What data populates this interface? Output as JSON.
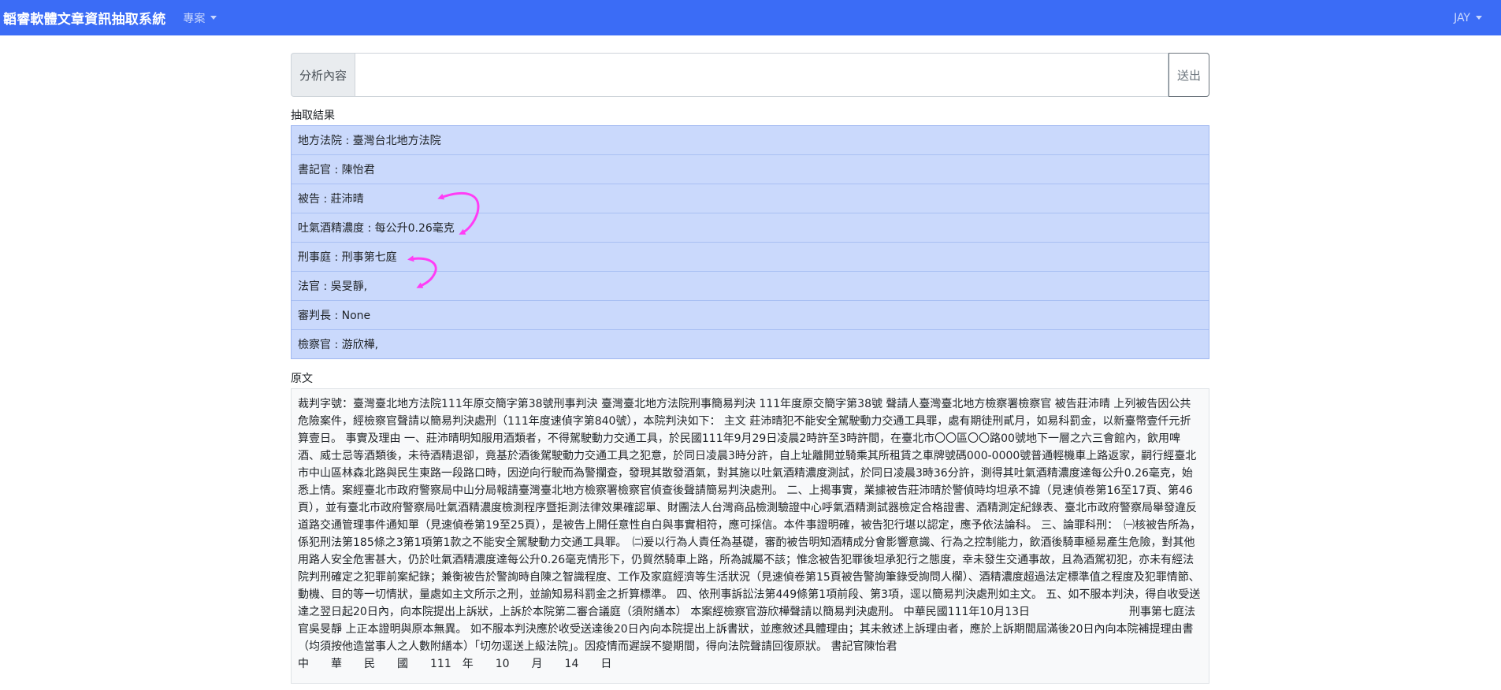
{
  "navbar": {
    "brand": "韜睿軟體文章資訊抽取系統",
    "menu_project": "專案",
    "user": "JAY"
  },
  "form": {
    "label": "分析內容",
    "input_value": "",
    "submit": "送出"
  },
  "results": {
    "heading": "抽取結果",
    "items": [
      "地方法院 : 臺灣台北地方法院",
      "書記官 : 陳怡君",
      "被告 : 莊沛晴",
      "吐氣酒精濃度 : 每公升0.26毫克",
      "刑事庭 : 刑事第七庭",
      "法官 : 吳旻靜,",
      "審判長 : None",
      "檢察官 : 游欣樺,"
    ]
  },
  "original": {
    "heading": "原文",
    "text": "裁判字號：臺灣臺北地方法院111年原交簡字第38號刑事判決 臺灣臺北地方法院刑事簡易判決 111年度原交簡字第38號 聲請人臺灣臺北地方檢察署檢察官 被告莊沛晴 上列被告因公共危險案件，經檢察官聲請以簡易判決處刑（111年度速偵字第840號），本院判決如下： 主文 莊沛晴犯不能安全駕駛動力交通工具罪，處有期徒刑貳月，如易科罰金，以新臺幣壹仟元折算壹日。 事實及理由 一、莊沛晴明知服用酒類者，不得駕駛動力交通工具，於民國111年9月29日凌晨2時許至3時許間，在臺北市〇〇區〇〇路00號地下一層之六三會館內，飲用啤酒、威士忌等酒類後，未待酒精退卻，竟基於酒後駕駛動力交通工具之犯意，於同日凌晨3時分許，自上址離開並騎乘其所租賃之車牌號碼000-0000號普通輕機車上路返家，嗣行經臺北市中山區林森北路與民生東路一段路口時，因逆向行駛而為警攔查，發現其散發酒氣，對其施以吐氣酒精濃度測試，於同日凌晨3時36分許，測得其吐氣酒精濃度達每公升0.26毫克，始悉上情。案經臺北市政府警察局中山分局報請臺灣臺北地方檢察署檢察官偵查後聲請簡易判決處刑。 二、上揭事實，業據被告莊沛晴於警偵時均坦承不諱（見速偵卷第16至17頁、第46頁），並有臺北市政府警察局吐氣酒精濃度檢測程序暨拒測法律效果確認單、財團法人台灣商品檢測驗證中心呼氣酒精測試器檢定合格證書、酒精測定紀錄表、臺北市政府警察局舉發違反道路交通管理事件通知單（見速偵卷第19至25頁），是被告上開任意性自白與事實相符，應可採信。本件事證明確，被告犯行堪以認定，應予依法論科。 三、論罪科刑：　㈠核被告所為，係犯刑法第185條之3第1項第1款之不能安全駕駛動力交通工具罪。　㈡爰以行為人責任為基礎，審酌被告明知酒精成分會影響意識、行為之控制能力，飲酒後騎車極易產生危險，對其他用路人安全危害甚大，仍於吐氣酒精濃度達每公升0.26毫克情形下，仍貿然騎車上路，所為誠屬不該；惟念被告犯罪後坦承犯行之態度，幸未發生交通事故，且為酒駕初犯，亦未有經法院判刑確定之犯罪前案紀錄；兼衡被告於警詢時自陳之智識程度、工作及家庭經濟等生活狀況（見速偵卷第15頁被告警詢筆錄受詢問人欄）、酒精濃度超過法定標準值之程度及犯罪情節、動機、目的等一切情狀，量處如主文所示之刑，並諭知易科罰金之折算標準。 四、依刑事訴訟法第449條第1項前段、第3項，逕以簡易判決處刑如主文。 五、如不服本判決，得自收受送達之翌日起20日內，向本院提出上訴狀，上訴於本院第二審合議庭（須附繕本） 本案經檢察官游欣樺聲請以簡易判決處刑。 中華民國111年10月13日　　　　　　　　　刑事第七庭法　官吳旻靜 上正本證明與原本無異。 如不服本判決應於收受送達後20日內向本院提出上訴書狀，並應敘述具體理由；其未敘述上訴理由者，應於上訴期間屆滿後20日內向本院補提理由書（均須按他造當事人之人數附繕本）「切勿逕送上級法院」。因疫情而遲誤不變期間，得向法院聲請回復原狀。 書記官陳怡君",
    "date_line": "中　　華　　民　　國　　111　年　　10　　月　　14　　日"
  },
  "colors": {
    "navbar": "#3b6cf6",
    "result_bg": "#cad9fc",
    "arrow": "#ff3df5"
  }
}
